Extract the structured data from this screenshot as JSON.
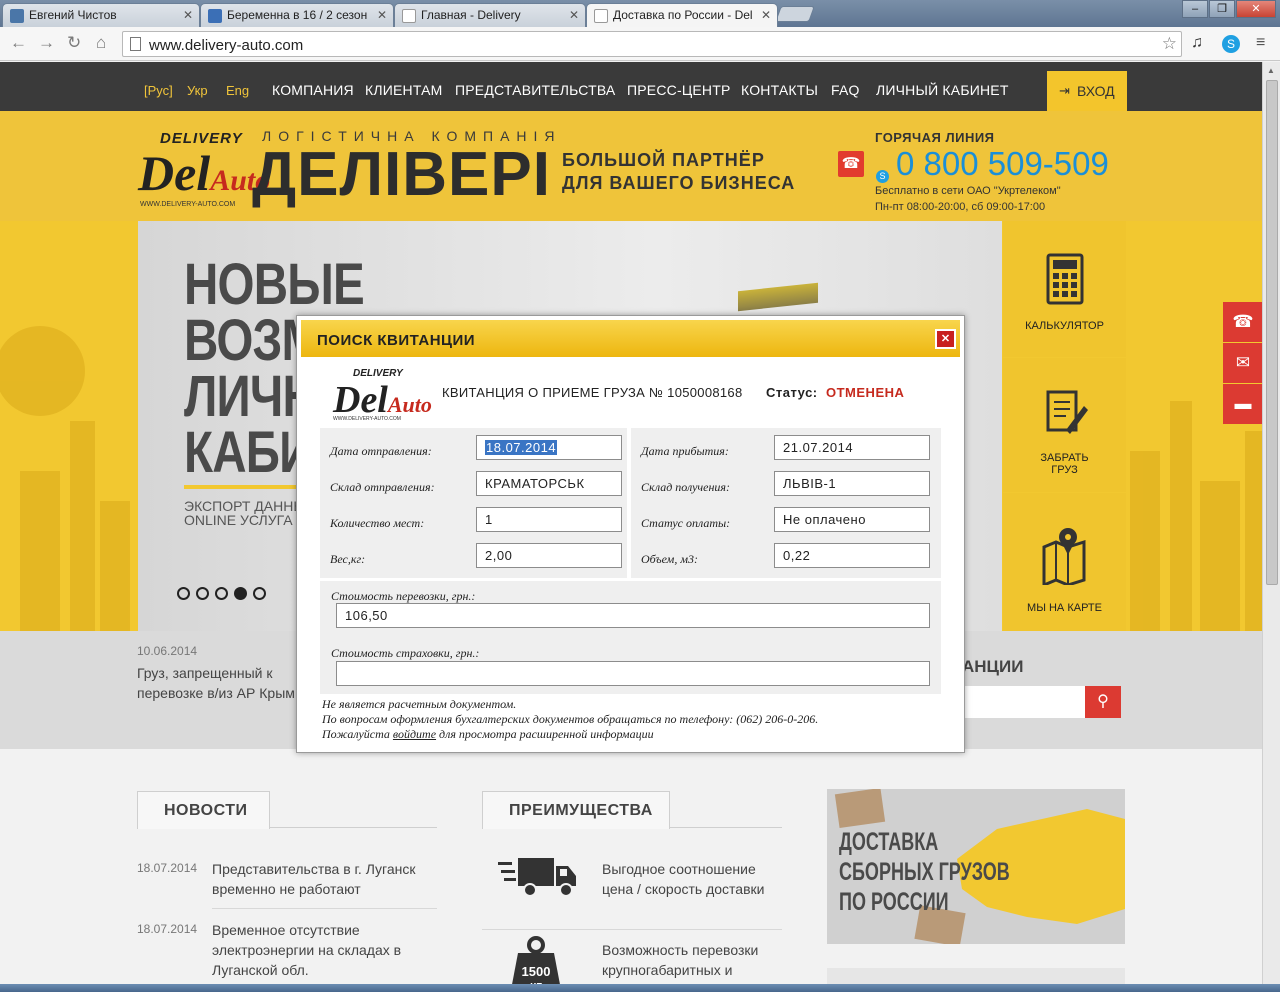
{
  "browser": {
    "tabs": [
      {
        "title": "Евгений Чистов",
        "favicon_color": "#4a76a8"
      },
      {
        "title": "Беременна в 16 / 2 сезон",
        "favicon_color": "#3b6fb6"
      },
      {
        "title": "Главная - Delivery",
        "favicon_color": "#e8e8e8"
      },
      {
        "title": "Доставка по России - Del",
        "favicon_color": "#e8e8e8"
      }
    ],
    "url": "www.delivery-auto.com"
  },
  "site": {
    "langs": [
      "[Рус]",
      "Укр",
      "Eng"
    ],
    "menu": [
      "КОМПАНИЯ",
      "КЛИЕНТАМ",
      "ПРЕДСТАВИТЕЛЬСТВА",
      "ПРЕСС-ЦЕНТР",
      "КОНТАКТЫ",
      "FAQ",
      "ЛИЧНЫЙ КАБИНЕТ"
    ],
    "login": "ВХОД"
  },
  "header": {
    "logo_top": "DELIVERY",
    "logo_main": "Del",
    "logo_sub": "Auto",
    "logo_url": "WWW.DELIVERY-AUTO.COM",
    "tagline": "ЛОГІСТИЧНА КОМПАНІЯ",
    "brand": "ДЕЛІВЕРІ",
    "slogan_1": "БОЛЬШОЙ ПАРТНЁР",
    "slogan_2": "ДЛЯ ВАШЕГО БИЗНЕСА",
    "hotline_label": "ГОРЯЧАЯ ЛИНИЯ",
    "phone": "0 800 509-509",
    "free_line": "Бесплатно в сети ОАО \"Укртелеком\"",
    "hours": "Пн-пт 08:00-20:00, сб 09:00-17:00"
  },
  "slider": {
    "title_lines": [
      "НОВЫЕ",
      "ВОЗМ",
      "ЛИЧН",
      "КАБИ"
    ],
    "sub_1": "ЭКСПОРТ ДАННЬ",
    "sub_2": "ONLINE УСЛУГА \"",
    "dots": 5,
    "active_dot": 3
  },
  "side": {
    "calculator": "КАЛЬКУЛЯТОР",
    "pickup_1": "ЗАБРАТЬ",
    "pickup_2": "ГРУЗ",
    "map": "МЫ НА КАРТЕ"
  },
  "strip": {
    "date": "10.06.2014",
    "text": "Груз, запрещенный к перевозке в/из АР Крым",
    "search_title": "АНЦИИ"
  },
  "news": {
    "title": "НОВОСТИ",
    "items": [
      {
        "date": "18.07.2014",
        "text": "Представительства в г. Луганск временно не работают"
      },
      {
        "date": "18.07.2014",
        "text": "Временное отсутствие электроэнергии на складах в Луганской обл."
      }
    ]
  },
  "advantages": {
    "title": "ПРЕИМУЩЕСТВА",
    "items": [
      {
        "text": "Выгодное соотношение цена / скорость доставки"
      },
      {
        "text": "Возможность перевозки крупногабаритных и"
      }
    ],
    "weight_label": "1500",
    "weight_unit": "КГ"
  },
  "promo": {
    "lines": [
      "ДОСТАВКА",
      "СБОРНЫХ ГРУЗОВ",
      "ПО РОССИИ"
    ]
  },
  "modal": {
    "title": "ПОИСК КВИТАНЦИИ",
    "close": "✕",
    "receipt": "КВИТАНЦИЯ О ПРИЕМЕ ГРУЗА № 1050008168",
    "status_label": "Статус:",
    "status_value": "ОТМЕНЕНА",
    "fields_left": [
      {
        "label": "Дата отправления:",
        "value": "18.07.2014"
      },
      {
        "label": "Склад отправления:",
        "value": "КРАМАТОРСЬК"
      },
      {
        "label": "Количество мест:",
        "value": "1"
      },
      {
        "label": "Вес,кг:",
        "value": "2,00"
      }
    ],
    "fields_right": [
      {
        "label": "Дата прибытия:",
        "value": "21.07.2014"
      },
      {
        "label": "Склад получения:",
        "value": "ЛЬВІВ-1"
      },
      {
        "label": "Статус оплаты:",
        "value": "Не оплачено"
      },
      {
        "label": "Объем, м3:",
        "value": "0,22"
      }
    ],
    "cost_label": "Стоимость перевозки, грн.:",
    "cost_value": "106,50",
    "insurance_label": "Стоимость страховки, грн.:",
    "insurance_value": "",
    "note_1": "Не является расчетным документом.",
    "note_2": "По вопросам оформления бухгалтерских документов обращаться по телефону: (062) 206-0-206.",
    "note_3_pre": "Пожалуйста ",
    "note_3_link": "войдите",
    "note_3_post": " для просмотра расширенной информации"
  },
  "colors": {
    "brand_yellow": "#f2c830",
    "accent_red": "#dc3a32",
    "phone_blue": "#1a8fd8",
    "status_red": "#c62a1e"
  }
}
